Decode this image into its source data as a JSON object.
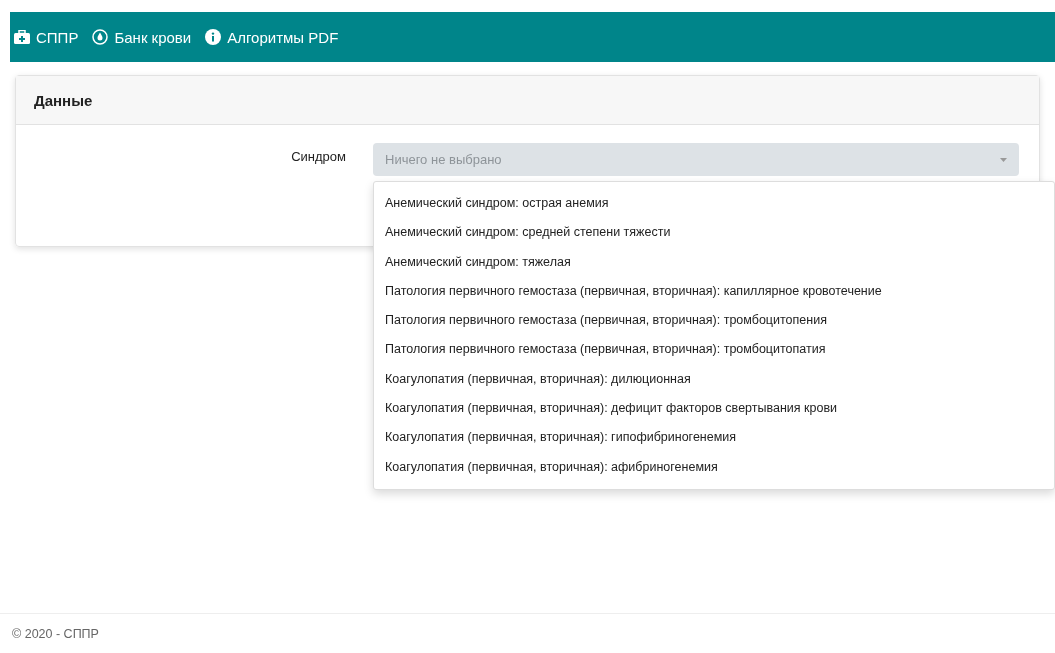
{
  "navbar": {
    "items": [
      {
        "kind": "kit",
        "label": "СППР"
      },
      {
        "kind": "drop",
        "label": "Банк крови"
      },
      {
        "kind": "info",
        "label": "Алгоритмы PDF"
      }
    ]
  },
  "card": {
    "title": "Данные",
    "field_label": "Синдром",
    "select": {
      "placeholder": "Ничего не выбрано",
      "expanded": true
    },
    "options": [
      "Анемический синдром: острая анемия",
      "Анемический синдром: средней степени тяжести",
      "Анемический синдром: тяжелая",
      "Патология первичного гемостаза (первичная, вторичная): капиллярное кровотечение",
      "Патология первичного гемостаза (первичная, вторичная): тромбоцитопения",
      "Патология первичного гемостаза (первичная, вторичная): тромбоцитопатия",
      "Коагулопатия (первичная, вторичная): дилюционная",
      "Коагулопатия (первичная, вторичная): дефицит факторов свертывания крови",
      "Коагулопатия (первичная, вторичная): гипофибриногенемия",
      "Коагулопатия (первичная, вторичная): афибриногенемия"
    ]
  },
  "footer": {
    "text": "© 2020 - СППР"
  }
}
